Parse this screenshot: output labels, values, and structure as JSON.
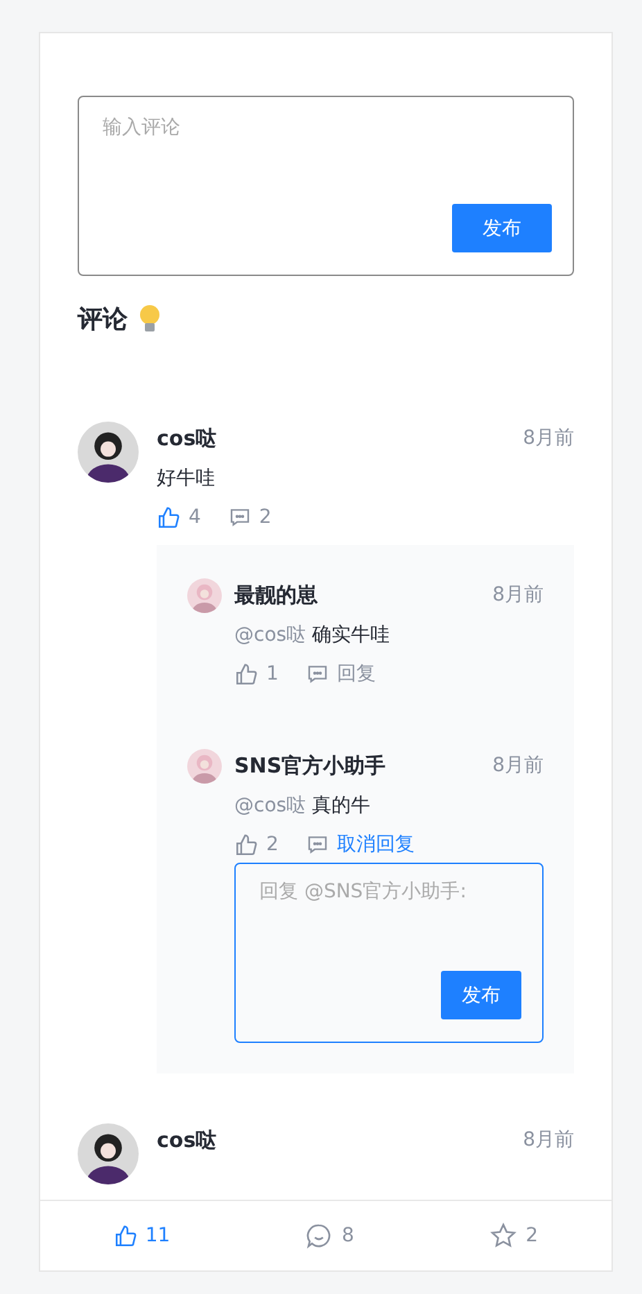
{
  "composer": {
    "placeholder": "输入评论",
    "button": "发布"
  },
  "heading": "评论",
  "comments": [
    {
      "author": "cos哒",
      "time": "8月前",
      "text": "好牛哇",
      "likes": "4",
      "liked": true,
      "replies_count": "2",
      "replies": [
        {
          "author": "最靓的崽",
          "time": "8月前",
          "mention": "@cos哒",
          "text": "确实牛哇",
          "likes": "1",
          "liked": false,
          "reply_label": "回复",
          "replying": false
        },
        {
          "author": "SNS官方小助手",
          "time": "8月前",
          "mention": "@cos哒",
          "text": "真的牛",
          "likes": "2",
          "liked": false,
          "reply_label": "取消回复",
          "replying": true,
          "reply_box": {
            "placeholder": "回复 @SNS官方小助手:",
            "button": "发布"
          }
        }
      ]
    },
    {
      "author": "cos哒",
      "time": "8月前"
    }
  ],
  "bottom_bar": {
    "likes": "11",
    "liked": true,
    "comments": "8",
    "stars": "2",
    "starred": false
  }
}
